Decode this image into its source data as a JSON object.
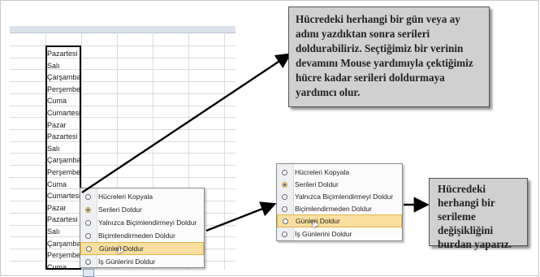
{
  "sheet": {
    "cells": [
      "Pazartesi",
      "Salı",
      "Çarşamba",
      "Perşembe",
      "Cuma",
      "Cumartesi",
      "Pazar",
      "Pazartesi",
      "Salı",
      "Çarşamba",
      "Perşembe",
      "Cuma",
      "Cumartesi",
      "Pazar",
      "Pazartesi",
      "Salı",
      "Çarşamba",
      "Perşembe",
      "Cuma"
    ]
  },
  "menu": {
    "items": [
      {
        "label": "Hücreleri Kopyala"
      },
      {
        "label": "Serileri Doldur"
      },
      {
        "label": "Yalnızca Biçimlendirmeyi Doldur"
      },
      {
        "label": "Biçimlendirmeden Doldur"
      },
      {
        "label": "Günleri Doldur"
      },
      {
        "label": "İş Günlerini Doldur"
      }
    ]
  },
  "callouts": {
    "top": "Hücredeki herhangi bir gün veya ay adını yazdıktan sonra serileri doldurabiliriz. Seçtiğimiz bir verinin devamını Mouse yardımıyla çektiğimiz hücre kadar serileri doldurmaya yardımcı olur.",
    "right": "Hücredeki herhangi bir serileme değişikliğini burdan yaparız."
  },
  "colors": {
    "callout_bg": "#d0d0d0",
    "highlight": "#f9df9f",
    "grid_header": "#dde3ec"
  }
}
